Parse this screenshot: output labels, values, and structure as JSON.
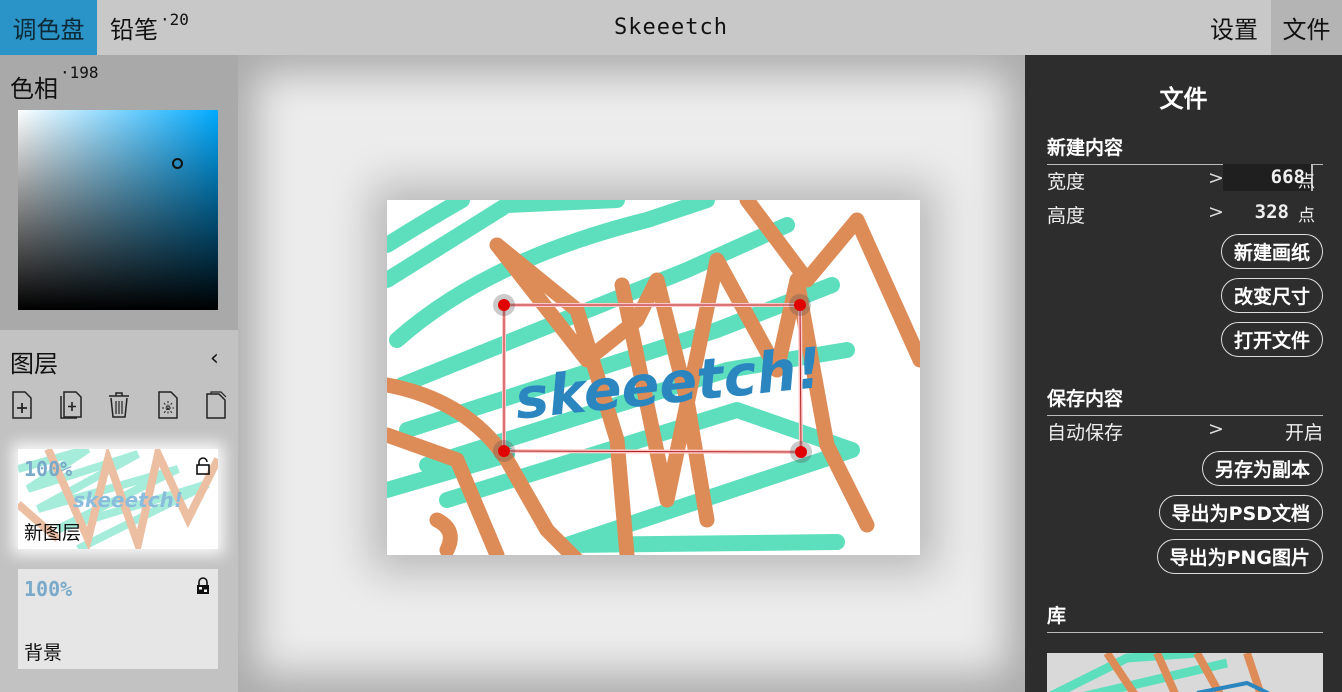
{
  "topbar": {
    "palette_tab": "调色盘",
    "pencil_tab": "铅笔",
    "pencil_size": "·20",
    "title": "Skeeetch",
    "settings_tab": "设置",
    "file_tab": "文件"
  },
  "color": {
    "hue_label": "色相",
    "hue_value": "·198"
  },
  "layers": {
    "title": "图层",
    "items": [
      {
        "opacity": "100%",
        "name": "新图层"
      },
      {
        "opacity": "100%",
        "name": "背景"
      }
    ]
  },
  "canvas": {
    "text": "skeeetch!"
  },
  "file_panel": {
    "title": "文件",
    "new_section": "新建内容",
    "width_label": "宽度",
    "width_value": "668",
    "height_label": "高度",
    "height_value": "328",
    "unit": "点",
    "new_canvas_btn": "新建画纸",
    "resize_btn": "改变尺寸",
    "open_btn": "打开文件",
    "save_section": "保存内容",
    "autosave_label": "自动保存",
    "autosave_value": "开启",
    "save_copy_btn": "另存为副本",
    "export_psd_btn": "导出为PSD文档",
    "export_png_btn": "导出为PNG图片",
    "library_section": "库"
  },
  "colors": {
    "accent": "#2a93c7",
    "teal_stroke": "#5ddfbd",
    "orange_stroke": "#dd8b57",
    "blue_text": "#2b86c0",
    "handle": "#e00000"
  },
  "icons": [
    "new-layer-icon",
    "new-group-icon",
    "delete-icon",
    "clear-icon",
    "layer-copy-icon",
    "lock-icon",
    "chevron-left-icon",
    "chevron-right-icon"
  ]
}
